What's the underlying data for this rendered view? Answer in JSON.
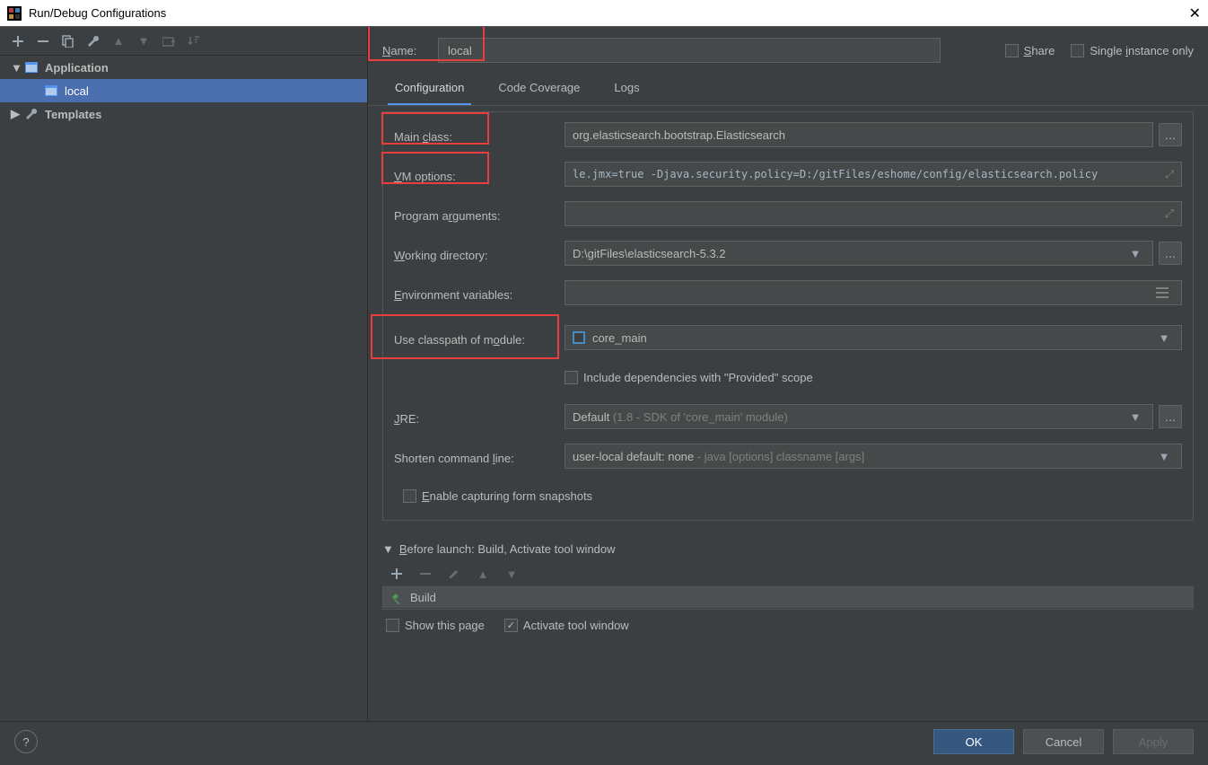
{
  "window": {
    "title": "Run/Debug Configurations"
  },
  "tree": {
    "application": "Application",
    "local": "local",
    "templates": "Templates"
  },
  "name": {
    "label": "Name:",
    "value": "local"
  },
  "share": {
    "share_label": "Share",
    "single_label": "Single instance only"
  },
  "tabs": {
    "configuration": "Configuration",
    "coverage": "Code Coverage",
    "logs": "Logs"
  },
  "form": {
    "main_class_label": "Main class:",
    "main_class_value": "org.elasticsearch.bootstrap.Elasticsearch",
    "vm_options_label": "VM options:",
    "vm_options_value": "le.jmx=true -Djava.security.policy=D:/gitFiles/eshome/config/elasticsearch.policy",
    "prog_args_label": "Program arguments:",
    "prog_args_value": "",
    "work_dir_label": "Working directory:",
    "work_dir_value": "D:\\gitFiles\\elasticsearch-5.3.2",
    "env_vars_label": "Environment variables:",
    "env_vars_value": "",
    "classpath_label": "Use classpath of module:",
    "classpath_value": "core_main",
    "include_provided": "Include dependencies with \"Provided\" scope",
    "jre_label": "JRE:",
    "jre_value": "Default",
    "jre_hint": " (1.8 - SDK of 'core_main' module)",
    "shorten_label": "Shorten command line:",
    "shorten_value": "user-local default: none",
    "shorten_hint": " - java [options] classname [args]",
    "enable_snapshots": "Enable capturing form snapshots"
  },
  "before_launch": {
    "title": "Before launch: Build, Activate tool window",
    "build": "Build",
    "show_page": "Show this page",
    "activate_window": "Activate tool window"
  },
  "footer": {
    "ok": "OK",
    "cancel": "Cancel",
    "apply": "Apply"
  }
}
